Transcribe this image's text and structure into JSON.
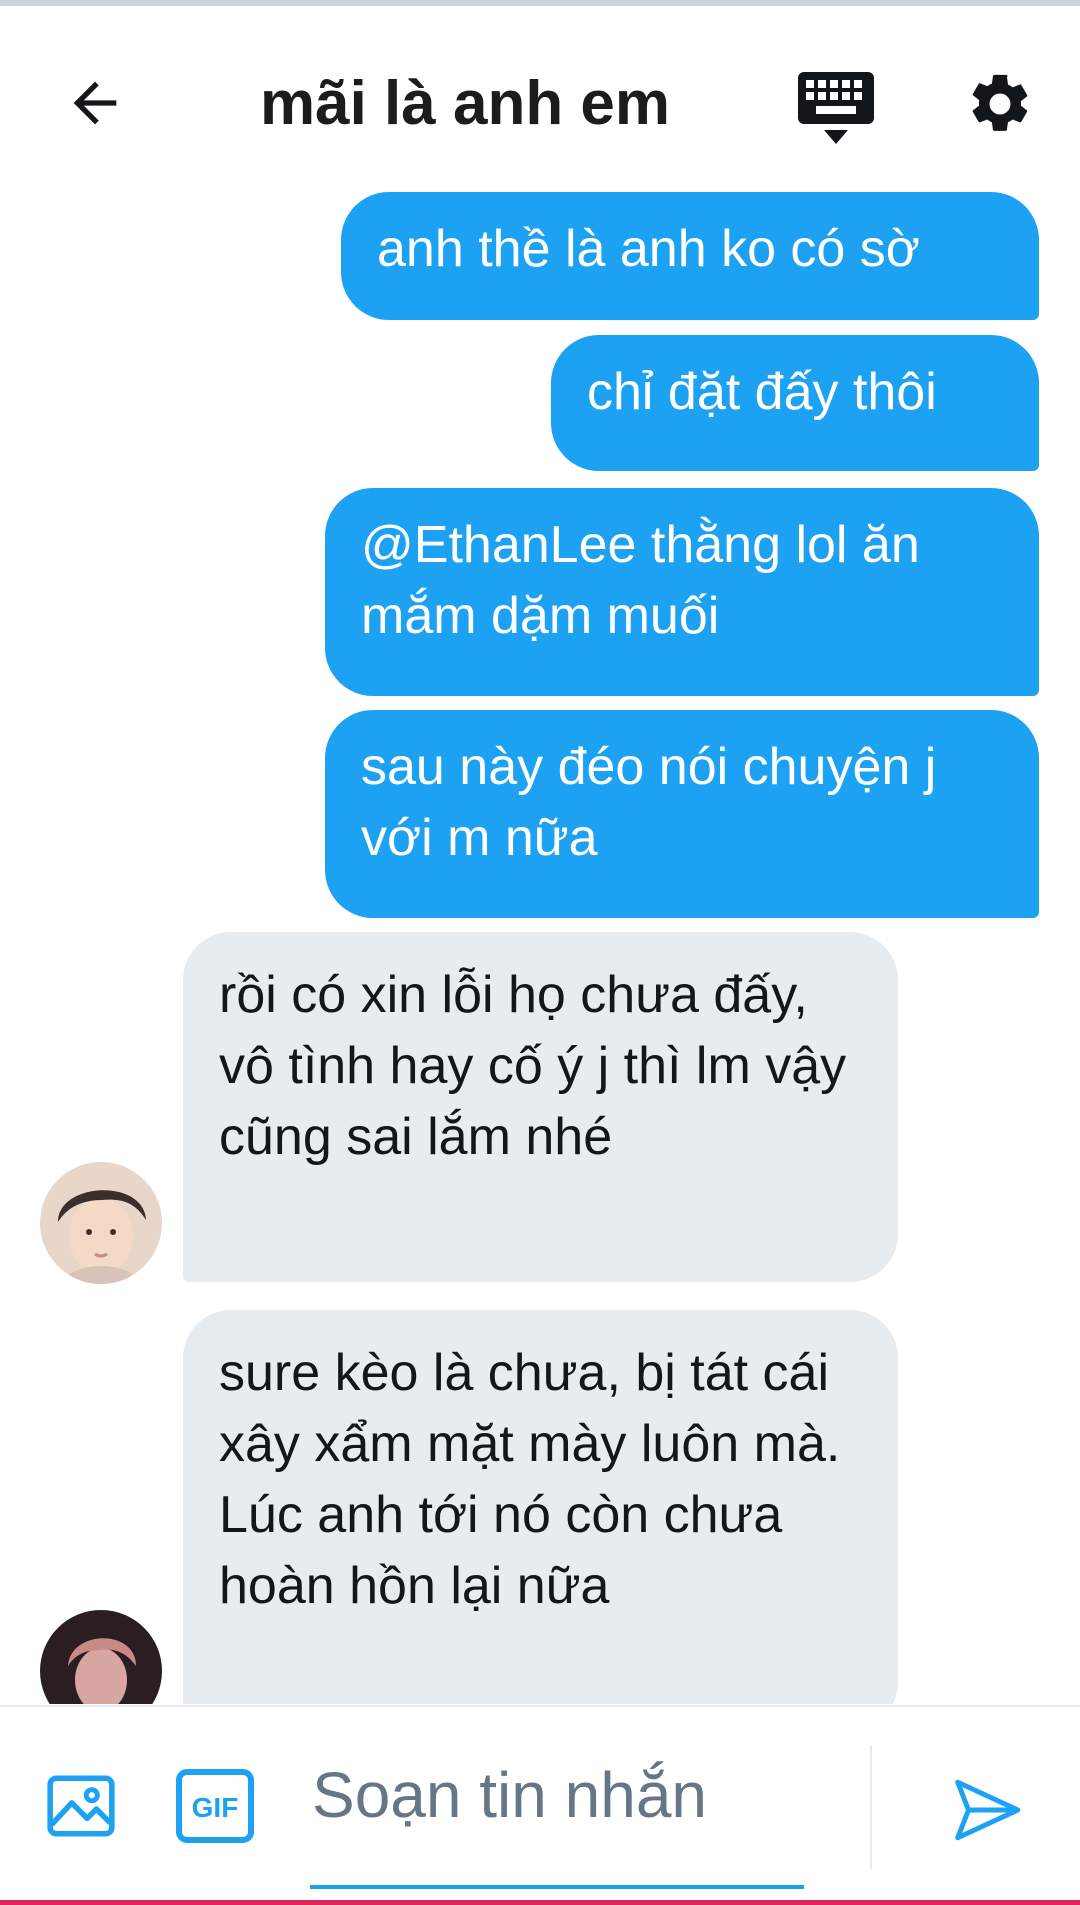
{
  "header": {
    "title": "mãi là anh em",
    "back_icon": "arrow-left-icon",
    "keyboard_icon": "keyboard-icon",
    "settings_icon": "gear-icon"
  },
  "messages": [
    {
      "from": "me",
      "text": "anh thề là anh ko có sờ"
    },
    {
      "from": "me",
      "text": "chỉ đặt đấy thôi"
    },
    {
      "from": "me",
      "text": "@EthanLee thằng lol ăn mắm dặm muối"
    },
    {
      "from": "me",
      "text": "sau này đéo nói chuyện j với m nữa"
    },
    {
      "from": "them",
      "text": "rồi có xin lỗi họ chưa đấy, vô tình hay cố ý j thì lm vậy cũng sai lắm nhé"
    },
    {
      "from": "them",
      "text": "sure kèo là chưa, bị tát cái xây xẩm mặt mày luôn mà. Lúc anh tới nó còn chưa hoàn hồn lại nữa"
    }
  ],
  "composer": {
    "placeholder": "Soạn tin nhắn",
    "gif_label": "GIF",
    "image_icon": "image-icon",
    "send_icon": "send-icon"
  },
  "colors": {
    "accent": "#1da1f2",
    "received_bubble": "#e6ecf0",
    "text": "#14171a",
    "placeholder": "#657786"
  }
}
